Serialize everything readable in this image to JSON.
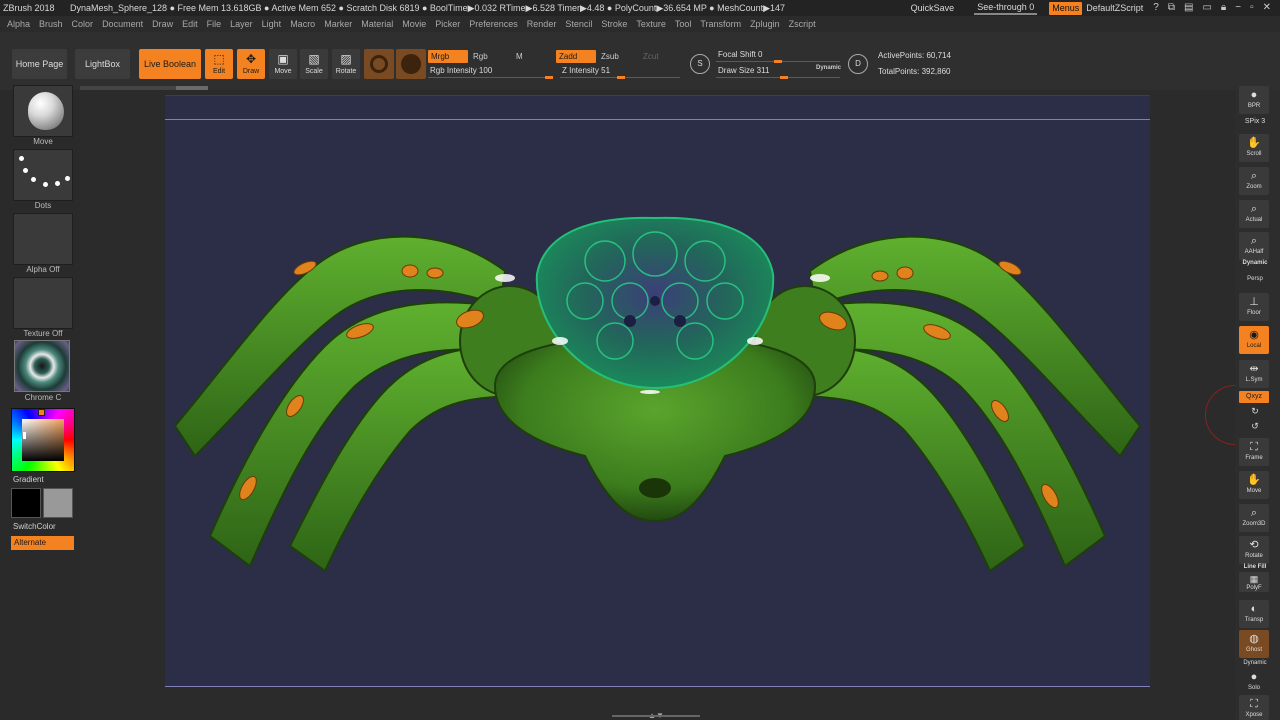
{
  "titlebar": {
    "app": "ZBrush 2018",
    "stats": "DynaMesh_Sphere_128    ● Free Mem 13.618GB ● Active Mem 652 ● Scratch Disk 6819 ●  BoolTime▶0.032 RTime▶6.528 Timer▶4.48 ● PolyCount▶36.654 MP ● MeshCount▶147",
    "quicksave": "QuickSave",
    "seethrough": "See-through  0",
    "menus": "Menus",
    "script": "DefaultZScript"
  },
  "menubar": [
    "Alpha",
    "Brush",
    "Color",
    "Document",
    "Draw",
    "Edit",
    "File",
    "Layer",
    "Light",
    "Macro",
    "Marker",
    "Material",
    "Movie",
    "Picker",
    "Preferences",
    "Render",
    "Stencil",
    "Stroke",
    "Texture",
    "Tool",
    "Transform",
    "Zplugin",
    "Zscript"
  ],
  "shelf": {
    "home_page": "Home Page",
    "lightbox": "LightBox",
    "live_boolean": "Live Boolean",
    "edit": "Edit",
    "draw": "Draw",
    "move": "Move",
    "scale": "Scale",
    "rotate": "Rotate",
    "mrgb": "Mrgb",
    "rgb": "Rgb",
    "m": "M",
    "rgb_intensity": "Rgb Intensity 100",
    "rgb_intensity_value": 100,
    "zadd": "Zadd",
    "zsub": "Zsub",
    "zcut": "Zcut",
    "z_intensity": "Z Intensity 51",
    "z_intensity_value": 51,
    "s_icon_label": "S",
    "d_icon_label": "D",
    "focal_shift": "Focal Shift 0",
    "focal_shift_value": 0,
    "draw_size": "Draw Size 311",
    "draw_size_value": 311,
    "dynamic": "Dynamic",
    "active_points": "ActivePoints: 60,714",
    "total_points": "TotalPoints: 392,860"
  },
  "left": {
    "brush": "Move",
    "stroke": "Dots",
    "alpha": "Alpha Off",
    "texture": "Texture Off",
    "material": "Chrome C",
    "gradient": "Gradient",
    "switchcolor": "SwitchColor",
    "alternate": "Alternate",
    "main_color": "#000000",
    "secondary_color": "#999999"
  },
  "right": {
    "bpr": "BPR",
    "spix": "SPix 3",
    "scroll": "Scroll",
    "zoom": "Zoom",
    "actual": "Actual",
    "aahalf": "AAHalf",
    "dynamic": "Dynamic",
    "persp": "Persp",
    "floor": "Floor",
    "local": "Local",
    "lsym": "L.Sym",
    "xyz": "Qxyz",
    "frame": "Frame",
    "move": "Move",
    "zoom3d": "Zoom3D",
    "rotate": "Rotate",
    "linefill": "Line Fill",
    "polyf": "PolyF",
    "transp": "Transp",
    "ghost": "Ghost",
    "dynamic2": "Dynamic",
    "solo": "Solo",
    "xpose": "Xpose"
  },
  "colors": {
    "accent": "#f58220",
    "canvas": "#2c2d47",
    "spider_green": "#3f7e1f",
    "spider_head": "#1e5f54",
    "spots": "#e0831c"
  }
}
